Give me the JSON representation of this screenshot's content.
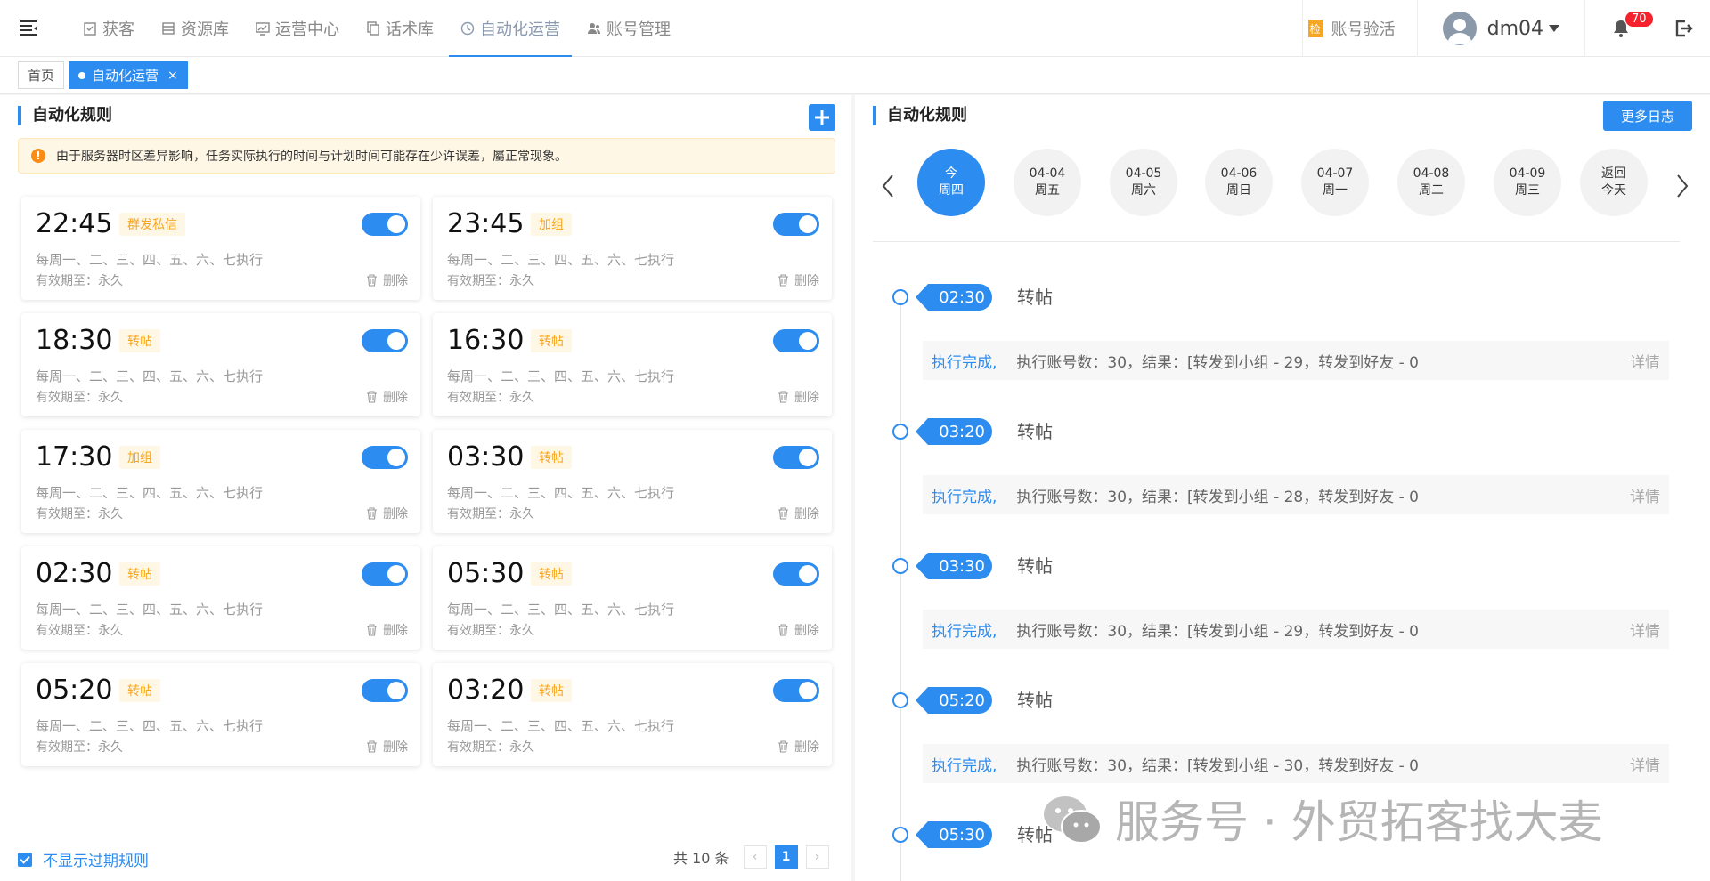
{
  "header": {
    "nav": [
      {
        "label": "获客",
        "icon": "clipboard-check-icon"
      },
      {
        "label": "资源库",
        "icon": "database-icon"
      },
      {
        "label": "运营中心",
        "icon": "chart-monitor-icon"
      },
      {
        "label": "话术库",
        "icon": "copy-docs-icon"
      },
      {
        "label": "自动化运营",
        "icon": "clock-icon",
        "active": true
      },
      {
        "label": "账号管理",
        "icon": "users-icon"
      }
    ],
    "verify_icon_text": "检",
    "verify_label": "账号验活",
    "username": "dm04",
    "notification_count": "70"
  },
  "tabs": [
    {
      "label": "首页"
    },
    {
      "label": "自动化运营",
      "close": "×",
      "active": true
    }
  ],
  "left": {
    "title": "自动化规则",
    "notice_icon_text": "!",
    "notice": "由于服务器时区差异影响，任务实际执行的时间与计划时间可能存在少许误差，屬正常现象。",
    "delete_label": "删除",
    "rules": [
      {
        "time": "22:45",
        "tag": "群发私信",
        "days": "每周一、二、三、四、五、六、七执行",
        "valid": "有效期至：永久",
        "enabled": true
      },
      {
        "time": "23:45",
        "tag": "加组",
        "days": "每周一、二、三、四、五、六、七执行",
        "valid": "有效期至：永久",
        "enabled": true
      },
      {
        "time": "18:30",
        "tag": "转帖",
        "days": "每周一、二、三、四、五、六、七执行",
        "valid": "有效期至：永久",
        "enabled": true
      },
      {
        "time": "16:30",
        "tag": "转帖",
        "days": "每周一、二、三、四、五、六、七执行",
        "valid": "有效期至：永久",
        "enabled": true
      },
      {
        "time": "17:30",
        "tag": "加组",
        "days": "每周一、二、三、四、五、六、七执行",
        "valid": "有效期至：永久",
        "enabled": true
      },
      {
        "time": "03:30",
        "tag": "转帖",
        "days": "每周一、二、三、四、五、六、七执行",
        "valid": "有效期至：永久",
        "enabled": true
      },
      {
        "time": "02:30",
        "tag": "转帖",
        "days": "每周一、二、三、四、五、六、七执行",
        "valid": "有效期至：永久",
        "enabled": true
      },
      {
        "time": "05:30",
        "tag": "转帖",
        "days": "每周一、二、三、四、五、六、七执行",
        "valid": "有效期至：永久",
        "enabled": true
      },
      {
        "time": "05:20",
        "tag": "转帖",
        "days": "每周一、二、三、四、五、六、七执行",
        "valid": "有效期至：永久",
        "enabled": true
      },
      {
        "time": "03:20",
        "tag": "转帖",
        "days": "每周一、二、三、四、五、六、七执行",
        "valid": "有效期至：永久",
        "enabled": true
      }
    ],
    "hide_expired_label": "不显示过期规则",
    "pagination": {
      "total": "共 10 条",
      "prev": "‹",
      "current": "1",
      "next": "›"
    }
  },
  "right": {
    "title": "自动化规则",
    "more_logs": "更多日志",
    "days": [
      {
        "line1": "今",
        "line2": "周四",
        "active": true
      },
      {
        "line1": "04-04",
        "line2": "周五"
      },
      {
        "line1": "04-05",
        "line2": "周六"
      },
      {
        "line1": "04-06",
        "line2": "周日"
      },
      {
        "line1": "04-07",
        "line2": "周一"
      },
      {
        "line1": "04-08",
        "line2": "周二"
      },
      {
        "line1": "04-09",
        "line2": "周三"
      },
      {
        "line1": "返回",
        "line2": "今天"
      }
    ],
    "logs": [
      {
        "time": "02:30",
        "type": "转帖",
        "status": "执行完成,",
        "result": "执行账号数：30，结果：[转发到小组 - 29，转发到好友 - 0",
        "detail": "详情"
      },
      {
        "time": "03:20",
        "type": "转帖",
        "status": "执行完成,",
        "result": "执行账号数：30，结果：[转发到小组 - 28，转发到好友 - 0",
        "detail": "详情"
      },
      {
        "time": "03:30",
        "type": "转帖",
        "status": "执行完成,",
        "result": "执行账号数：30，结果：[转发到小组 - 29，转发到好友 - 0",
        "detail": "详情"
      },
      {
        "time": "05:20",
        "type": "转帖",
        "status": "执行完成,",
        "result": "执行账号数：30，结果：[转发到小组 - 30，转发到好友 - 0",
        "detail": "详情"
      },
      {
        "time": "05:30",
        "type": "转帖"
      }
    ]
  },
  "watermark": "服务号 · 外贸拓客找大麦"
}
